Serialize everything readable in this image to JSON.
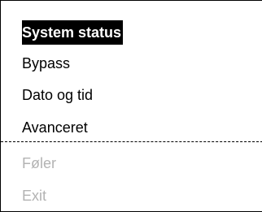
{
  "menu": {
    "items": [
      {
        "label": "System status",
        "selected": true,
        "enabled": true
      },
      {
        "label": "Bypass",
        "selected": false,
        "enabled": true
      },
      {
        "label": "Dato og tid",
        "selected": false,
        "enabled": true
      },
      {
        "label": "Avanceret",
        "selected": false,
        "enabled": true
      },
      {
        "label": "Føler",
        "selected": false,
        "enabled": false
      },
      {
        "label": "Exit",
        "selected": false,
        "enabled": false
      }
    ]
  }
}
